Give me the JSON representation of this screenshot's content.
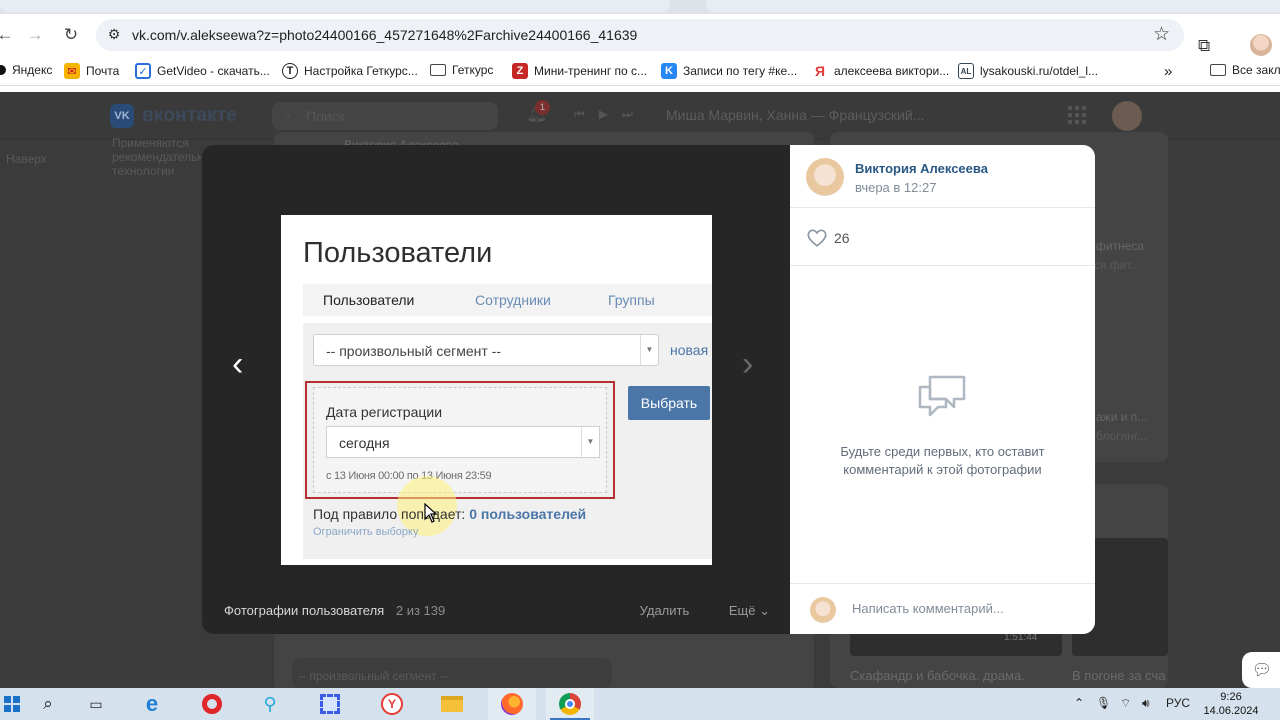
{
  "browser": {
    "url": "vk.com/v.alekseewa?z=photo24400166_457271648%2Farchive24400166_41639",
    "bookmarks": [
      {
        "label": "Яндекс",
        "icon": "yandex-icon"
      },
      {
        "label": "Почта",
        "icon": "mail-icon"
      },
      {
        "label": "GetVideo - скачать...",
        "icon": "getvideo-icon"
      },
      {
        "label": "Настройка Геткурс...",
        "icon": "getcourse-icon"
      },
      {
        "label": "Геткурс",
        "icon": "folder-icon"
      },
      {
        "label": "Мини-тренинг по с...",
        "icon": "zen-icon"
      },
      {
        "label": "Записи по тегу #ке...",
        "icon": "vk-icon"
      },
      {
        "label": "алексеева виктори...",
        "icon": "yandex-icon"
      },
      {
        "label": "lysakouski.ru/otdel_l...",
        "icon": "site-icon"
      }
    ],
    "more_bookmarks": "»",
    "all_bookmarks": "Все закл"
  },
  "vk": {
    "logo_badge": "VK",
    "logo_text": "вконтакте",
    "search_placeholder": "Поиск",
    "notifications_count": "1",
    "now_playing": "Миша Марвин, Ханна — Французский...",
    "background_texts": {
      "left_1": "Наверх",
      "left_2": "Применяются",
      "left_3": "рекомендательные",
      "left_4": "технологии",
      "feed_author": "Виктория Алексеева",
      "right_1": "фитнеса",
      "right_2": "Вся фит...",
      "right_3": "ажи и п...",
      "right_4": "блогинг...",
      "right_5": "Скафандр и бабочка. драма.",
      "right_6": "В погоне за сча",
      "right_7": "1:51:44",
      "behind_select": "-- произвольный сегмент --"
    }
  },
  "viewer": {
    "album": "Фотографии пользователя",
    "counter": "2 из 139",
    "delete": "Удалить",
    "more": "Ещё",
    "photo": {
      "title": "Пользователи",
      "tabs": [
        "Пользователи",
        "Сотрудники",
        "Группы"
      ],
      "segment_select": "-- произвольный сегмент --",
      "new_link": "новая",
      "date_label": "Дата регистрации",
      "date_value": "сегодня",
      "date_range": "с 13 Июня 00:00 по 13 Июня 23:59",
      "choose_button": "Выбрать",
      "rule_text": "Под правило попадает:",
      "rule_count": "0 пользователей",
      "limit_link": "Ограничить выборку"
    }
  },
  "side_panel": {
    "author": "Виктория Алексеева",
    "time": "вчера в 12:27",
    "likes": "26",
    "empty_comments": "Будьте среди первых, кто оставит комментарий к этой фотографии",
    "comment_placeholder": "Написать комментарий..."
  },
  "taskbar": {
    "language": "РУС",
    "time": "9:26",
    "date": "14.06.2024"
  }
}
